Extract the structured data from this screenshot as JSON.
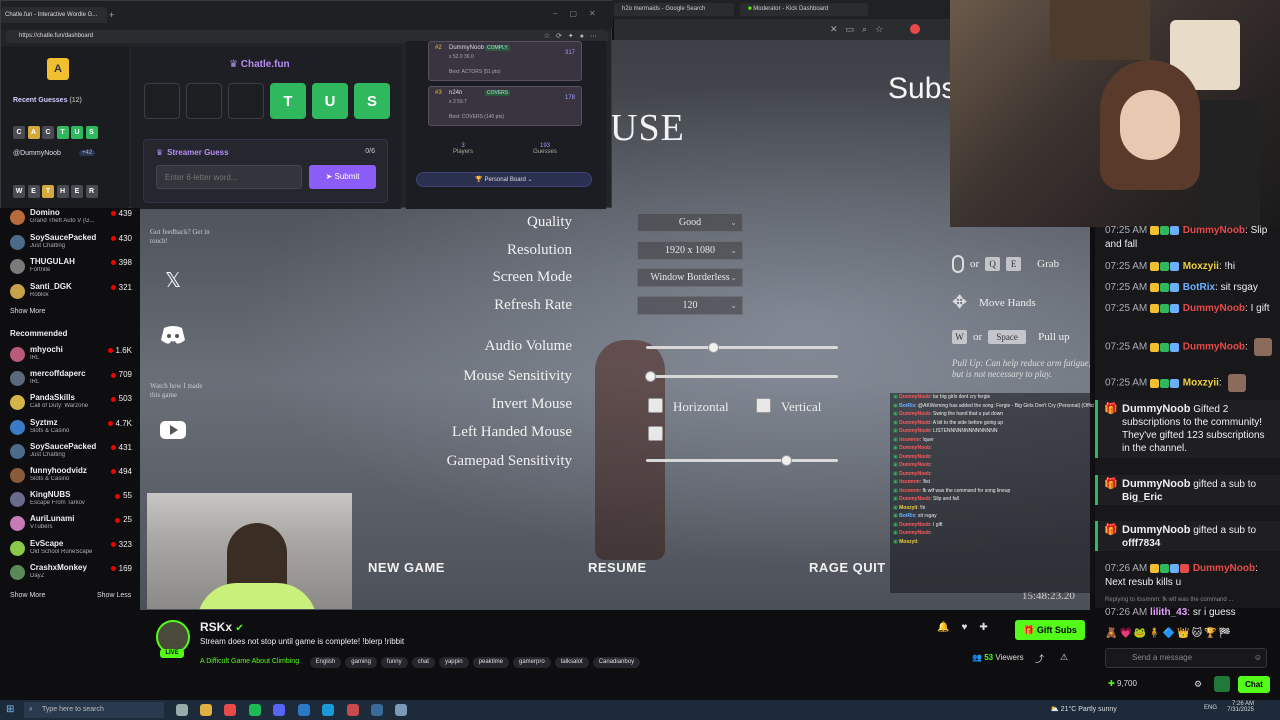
{
  "browser": {
    "tabs": [
      "Chatle.fun - Interactive Wordle G...",
      "h2o mermaids - Google Search",
      "Moderator - Kick Dashboard"
    ],
    "url": "https://chatle.fun/dashboard"
  },
  "chatle": {
    "logo_letter": "A",
    "brand": "Chatle.fun",
    "tiles": [
      "",
      "",
      "",
      "T",
      "U",
      "S"
    ],
    "recent_guesses_label": "Recent Guesses",
    "recent_guesses_count": "(12)",
    "guess1": [
      "C",
      "A",
      "C",
      "T",
      "U",
      "S"
    ],
    "guess1_user": "@DummyNoob",
    "guess1_points": "+42",
    "guess2": [
      "W",
      "E",
      "T",
      "H",
      "E",
      "R"
    ],
    "streamer_guess_label": "Streamer Guess",
    "streamer_guess_count": "0/6",
    "input_placeholder": "Enter 6-letter word...",
    "submit_label": "Submit",
    "board": [
      {
        "rank": "#2",
        "name": "DummyNoob",
        "badge": "COMPLY",
        "stats": "x 52.0 36.0",
        "pts": "317",
        "best": "Best: ACTORS (51 pts)"
      },
      {
        "rank": "#3",
        "name": "n24n",
        "badge": "COVERS",
        "stats": "x 3 59.7",
        "pts": "178",
        "best": "Best: COVERS (140 pts)"
      }
    ],
    "players_value": "3",
    "players_label": "Players",
    "guesses_value": "193",
    "guesses_label": "Guesses",
    "personal_board": "Personal Board"
  },
  "game": {
    "title": "USE",
    "subs_title": "Subs",
    "settings": [
      {
        "label": "Quality",
        "value": "Good"
      },
      {
        "label": "Resolution",
        "value": "1920 x 1080"
      },
      {
        "label": "Screen Mode",
        "value": "Window Borderless"
      },
      {
        "label": "Refresh Rate",
        "value": "120"
      }
    ],
    "audio_label": "Audio Volume",
    "audio_level": 0.35,
    "mouse_sens_label": "Mouse Sensitivity",
    "mouse_sens_level": 0.02,
    "invert_label": "Invert Mouse",
    "horizontal_label": "Horizontal",
    "vertical_label": "Vertical",
    "left_handed_label": "Left Handed Mouse",
    "gamepad_label": "Gamepad Sensitivity",
    "gamepad_level": 0.73,
    "new_game": "NEW GAME",
    "resume": "RESUME",
    "rage_quit": "RAGE QUIT",
    "timer": "15:48:23.20",
    "feedback_note": "Got feedback? Get in touch!",
    "watch_note": "Watch how I made this game",
    "controls": {
      "or": "or",
      "q": "Q",
      "e": "E",
      "grab": "Grab",
      "move_hands": "Move Hands",
      "w": "W",
      "space": "Space",
      "pull_up": "Pull up",
      "pull_note": "Pull Up: Can help reduce arm fatigue, but is not necessary to play.",
      "ghost_move": "Move Hands"
    }
  },
  "sidebar": {
    "followed": [
      {
        "name": "Domino",
        "game": "Grand Theft Auto V (G...",
        "viewers": "439",
        "color": "#b86a3c"
      },
      {
        "name": "SoySaucePacked",
        "game": "Just Chatting",
        "viewers": "430",
        "color": "#4a6b8a"
      },
      {
        "name": "THUGULAH",
        "game": "Fortnite",
        "viewers": "398",
        "color": "#7a7a7a"
      },
      {
        "name": "Santi_DGK",
        "game": "Roblox",
        "viewers": "321",
        "color": "#c9a14a"
      }
    ],
    "show_more": "Show More",
    "recommended_label": "Recommended",
    "recommended": [
      {
        "name": "mhyochi",
        "game": "IRL",
        "viewers": "1.6K",
        "color": "#b85a7a"
      },
      {
        "name": "mercoffdaperc",
        "game": "IRL",
        "viewers": "709",
        "color": "#5a6a7a"
      },
      {
        "name": "PandaSkills",
        "game": "Call of Duty: Warzone",
        "viewers": "503",
        "color": "#d4b44a"
      },
      {
        "name": "Syztmz",
        "game": "Slots & Casino",
        "viewers": "4.7K",
        "color": "#3a7ac8"
      },
      {
        "name": "SoySaucePacked",
        "game": "Just Chatting",
        "viewers": "431",
        "color": "#4a6b8a"
      },
      {
        "name": "funnyhoodvidz",
        "game": "Slots & Casino",
        "viewers": "494",
        "color": "#8a5a3a"
      },
      {
        "name": "KingNUBS",
        "game": "Escape From Tarkov",
        "viewers": "55",
        "color": "#6a6a8a"
      },
      {
        "name": "AuriLunami",
        "game": "VTubers",
        "viewers": "25",
        "color": "#c87ab8"
      },
      {
        "name": "EvScape",
        "game": "Old School RuneScape",
        "viewers": "323",
        "color": "#8ac84a"
      },
      {
        "name": "CrashxMonkey",
        "game": "DayZ",
        "viewers": "169",
        "color": "#5a8a5a"
      }
    ],
    "show_more2": "Show More",
    "show_less": "Show Less"
  },
  "chat": {
    "messages": [
      {
        "time": "07:25 AM",
        "user": "DummyNoob",
        "color": "#e84a4a",
        "text": "Slip and fall"
      },
      {
        "time": "07:25 AM",
        "user": "Moxzyii",
        "color": "#f0d040",
        "text": "!hi"
      },
      {
        "time": "07:25 AM",
        "user": "BotRix",
        "color": "#6ab0ff",
        "text": "sit rsgay"
      },
      {
        "time": "07:25 AM",
        "user": "DummyNoob",
        "color": "#e84a4a",
        "text": "I gift"
      },
      {
        "time": "07:25 AM",
        "user": "DummyNoob",
        "color": "#e84a4a",
        "text": ""
      },
      {
        "time": "07:25 AM",
        "user": "Moxzyii",
        "color": "#f0d040",
        "text": ""
      }
    ],
    "events": [
      {
        "user": "DummyNoob",
        "text": "Gifted 2 subscriptions to the community! They've gifted 123 subscriptions in the channel."
      },
      {
        "user": "DummyNoob",
        "text": "gifted a sub to",
        "target": "Big_Eric"
      },
      {
        "user": "DummyNoob",
        "text": "gifted a sub to",
        "target": "offf7834"
      }
    ],
    "last_msg_time": "07:26 AM",
    "last_msg_user": "DummyNoob",
    "last_msg_text": "Next resub kills u",
    "reply_note": "Replying to itssmnm: fk wtf was the command ...",
    "reply_time": "07:26 AM",
    "reply_user": "lilith_43",
    "reply_text": "sr i guess",
    "input_placeholder": "Send a message",
    "points": "9,700",
    "chat_button": "Chat"
  },
  "overlay_chat": [
    {
      "user": "DummyNoob",
      "color": "#ff5a5a",
      "text": "lar big girls dont cry fergie"
    },
    {
      "user": "BotRix",
      "color": "#6ab0ff",
      "text": "@AKWeming has added the song: Fergie - Big Girls Don't Cry (Personal) (Official Music Video) to the playlist."
    },
    {
      "user": "DummyNoob",
      "color": "#ff5a5a",
      "text": "Swing the hand that u put down"
    },
    {
      "user": "DummyNoob",
      "color": "#ff5a5a",
      "text": "A bit to the side before going up"
    },
    {
      "user": "DummyNoob",
      "color": "#ff5a5a",
      "text": "LISTENNNNNNNNNNNNNN"
    },
    {
      "user": "itssmnm",
      "color": "#ff5a5a",
      "text": "!quer"
    },
    {
      "user": "DummyNoob",
      "color": "#ff5a5a",
      "text": ""
    },
    {
      "user": "DummyNoob",
      "color": "#ff5a5a",
      "text": ""
    },
    {
      "user": "DummyNoob",
      "color": "#ff5a5a",
      "text": ""
    },
    {
      "user": "DummyNoob",
      "color": "#ff5a5a",
      "text": ""
    },
    {
      "user": "itssmnm",
      "color": "#ff5a5a",
      "text": "!list"
    },
    {
      "user": "itssmnm",
      "color": "#ff5a5a",
      "text": "fk wtf was the command for song lineup"
    },
    {
      "user": "DummyNoob",
      "color": "#ff5a5a",
      "text": "Slip and fall"
    },
    {
      "user": "Moxzyii",
      "color": "#f0d040",
      "text": "!hi"
    },
    {
      "user": "BotRix",
      "color": "#6ab0ff",
      "text": "sit rsgay"
    },
    {
      "user": "DummyNoob",
      "color": "#ff5a5a",
      "text": "I gift"
    },
    {
      "user": "DummyNoob",
      "color": "#ff5a5a",
      "text": ""
    },
    {
      "user": "Moxzyii",
      "color": "#f0d040",
      "text": ""
    }
  ],
  "stream": {
    "streamer": "RSKx",
    "live": "LIVE",
    "title": "Stream does not stop until game is complete! !blerp !ribbit",
    "category": "A Difficult Game About Climbing",
    "tags": [
      "English",
      "gaming",
      "funny",
      "chat",
      "yappin",
      "peaktime",
      "gamerpro",
      "talksalot",
      "Canadianboy"
    ],
    "gift_subs": "Gift Subs",
    "viewers": "53",
    "viewers_label": "Viewers"
  },
  "taskbar": {
    "search_placeholder": "Type here to search",
    "weather": "21°C  Partly sunny",
    "lang": "ENG",
    "time": "7:26 AM",
    "date": "7/31/2025"
  }
}
